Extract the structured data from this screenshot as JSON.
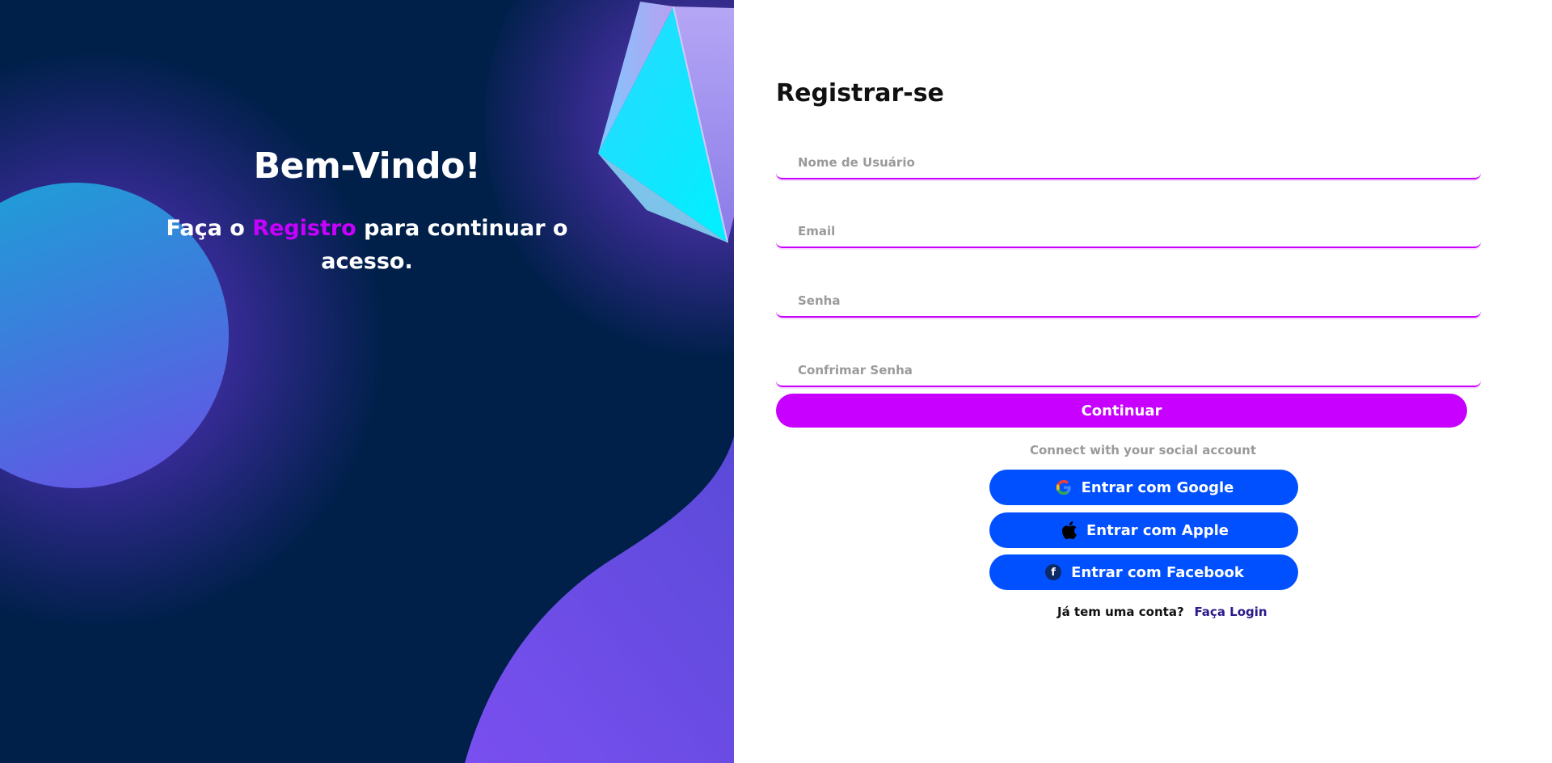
{
  "welcome": {
    "title": "Bem-Vindo!",
    "subtitle_prefix": "Faça o",
    "subtitle_highlight": "Registro",
    "subtitle_suffix": "para continuar o acesso."
  },
  "form": {
    "title": "Registrar-se",
    "fields": {
      "username_placeholder": "Nome de Usuário",
      "email_placeholder": "Email",
      "password_placeholder": "Senha",
      "confirm_password_placeholder": "Confrimar Senha"
    },
    "continue_label": "Continuar"
  },
  "social": {
    "caption": "Connect with your social account",
    "google_label": "Entrar com Google",
    "apple_label": "Entrar com Apple",
    "facebook_label": "Entrar com Facebook"
  },
  "footer": {
    "question": "Já tem uma conta?",
    "login_link": "Faça Login"
  },
  "colors": {
    "accent": "#c800ff",
    "social_button": "#0050ff",
    "left_background": "#00204a"
  }
}
